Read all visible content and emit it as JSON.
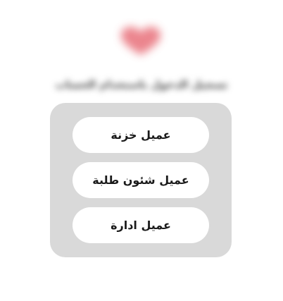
{
  "header": {
    "logo_icon": "heart-logo-icon",
    "logo_color": "#e8707a",
    "tagline": "تسجيل الدخول باستخدام الحساب"
  },
  "roles_panel": {
    "background": "#d9d9d9",
    "buttons": [
      {
        "label": "عميل خزنة"
      },
      {
        "label": "عميل شئون طلبة"
      },
      {
        "label": "عميل ادارة"
      }
    ]
  }
}
